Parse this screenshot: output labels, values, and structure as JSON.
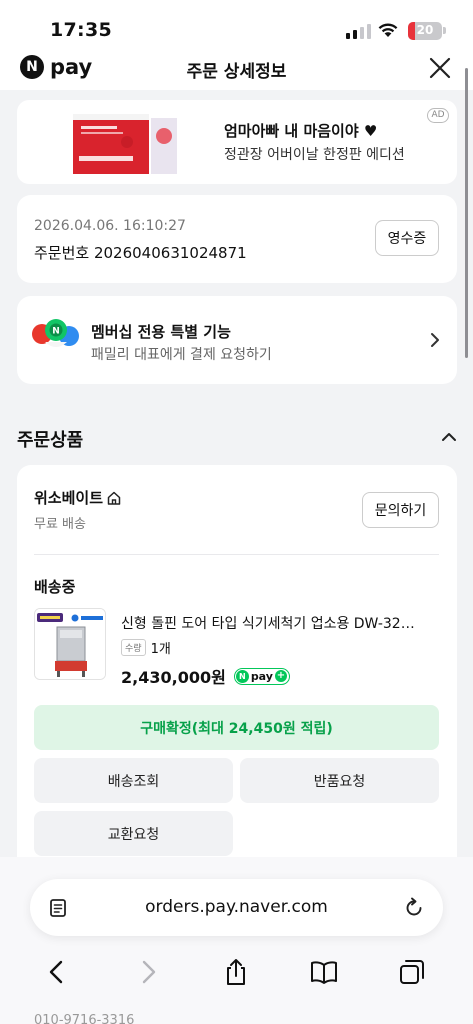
{
  "status_bar": {
    "time": "17:35",
    "battery": "20",
    "battery_level_percent": 20
  },
  "nav": {
    "logo_text": "pay",
    "logo_letter": "N",
    "title": "주문 상세정보"
  },
  "ad": {
    "title": "엄마아빠 내 마음이야 ♥",
    "subtitle": "정관장 어버이날 한정판 에디션",
    "badge": "AD"
  },
  "order": {
    "datetime": "2026.04.06. 16:10:27",
    "order_number": "주문번호 2026040631024871",
    "receipt_label": "영수증"
  },
  "membership": {
    "title": "멤버십 전용 특별 기능",
    "subtitle": "패밀리 대표에게 결제 요청하기"
  },
  "section": {
    "title": "주문상품"
  },
  "product": {
    "seller": "위소베이트",
    "shipping": "무료 배송",
    "inquiry_label": "문의하기",
    "status": "배송중",
    "name": "신형 돌핀 도어 타입 식기세척기 업소용 DW-32…",
    "qty_tag": "수량",
    "qty": "1개",
    "price": "2,430,000원",
    "pay_badge": "pay"
  },
  "actions": {
    "confirm": "구매확정(최대 24,450원 적립)",
    "track": "배송조회",
    "return": "반품요청",
    "exchange": "교환요청"
  },
  "background_text": {
    "phone": "010-9716-3316"
  },
  "browser": {
    "url": "orders.pay.naver.com"
  },
  "colors": {
    "brand_green": "#03c75a",
    "confirm_bg": "#dff5e6",
    "confirm_text": "#07a14a",
    "battery_red": "#e8333b"
  }
}
